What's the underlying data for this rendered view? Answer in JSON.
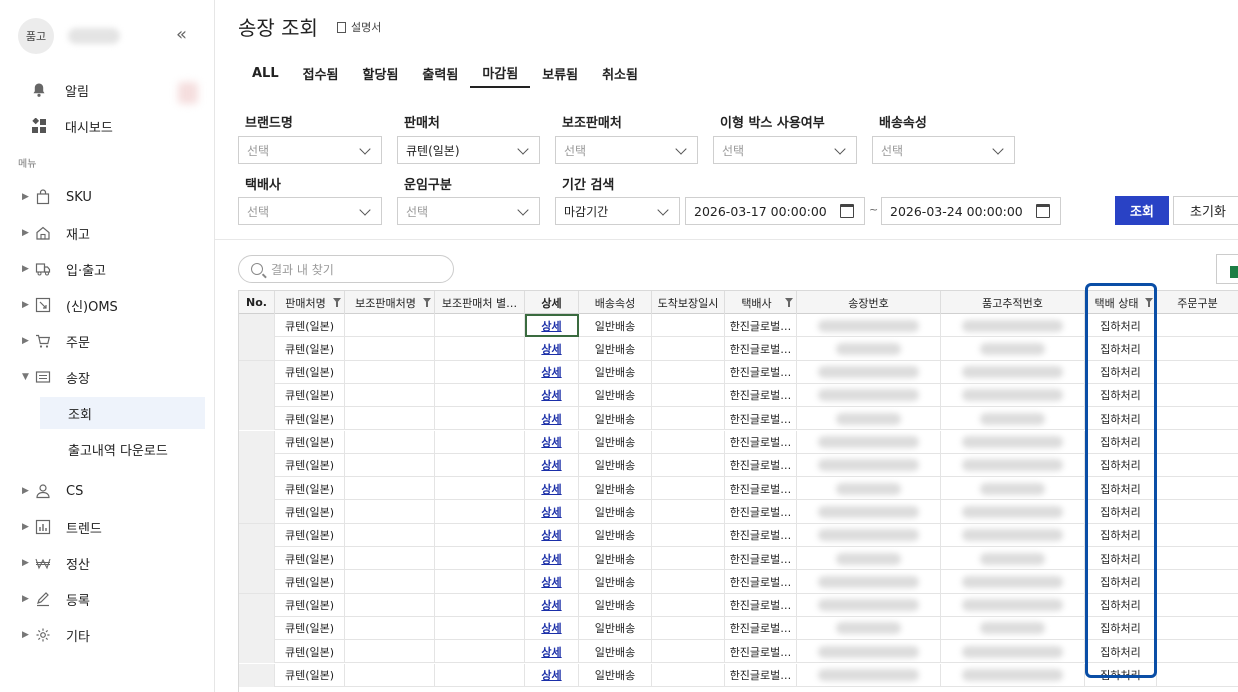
{
  "sidebar": {
    "avatar_text": "품고",
    "collapse_glyph": "«",
    "top_items": [
      {
        "label": "알림",
        "icon": "bell-icon"
      },
      {
        "label": "대시보드",
        "icon": "dashboard-icon"
      }
    ],
    "menu_label": "메뉴",
    "items": [
      {
        "label": "SKU",
        "icon": "bag-icon"
      },
      {
        "label": "재고",
        "icon": "home-icon"
      },
      {
        "label": "입·출고",
        "icon": "truck-icon"
      },
      {
        "label": "(신)OMS",
        "icon": "oms-icon"
      },
      {
        "label": "주문",
        "icon": "cart-icon"
      },
      {
        "label": "송장",
        "icon": "invoice-icon",
        "expanded": true
      },
      {
        "label": "CS",
        "icon": "person-icon"
      },
      {
        "label": "트렌드",
        "icon": "chart-icon"
      },
      {
        "label": "정산",
        "icon": "won-icon"
      },
      {
        "label": "등록",
        "icon": "pencil-icon"
      },
      {
        "label": "기타",
        "icon": "gear-icon"
      }
    ],
    "sub_items": [
      {
        "label": "조회",
        "active": true
      },
      {
        "label": "출고내역 다운로드",
        "active": false
      }
    ]
  },
  "header": {
    "title": "송장 조회",
    "manual_label": "설명서"
  },
  "tabs": [
    {
      "label": "ALL"
    },
    {
      "label": "접수됨"
    },
    {
      "label": "할당됨"
    },
    {
      "label": "출력됨"
    },
    {
      "label": "마감됨",
      "active": true
    },
    {
      "label": "보류됨"
    },
    {
      "label": "취소됨"
    }
  ],
  "filters": {
    "brand": {
      "label": "브랜드명",
      "value": "선택"
    },
    "seller": {
      "label": "판매처",
      "value": "큐텐(일본)"
    },
    "sub_seller": {
      "label": "보조판매처",
      "value": "선택"
    },
    "odd_box": {
      "label": "이형 박스 사용여부",
      "value": "선택"
    },
    "delivery_attr": {
      "label": "배송속성",
      "value": "선택"
    },
    "courier": {
      "label": "택배사",
      "value": "선택"
    },
    "fare_type": {
      "label": "운임구분",
      "value": "선택"
    },
    "period": {
      "label": "기간 검색",
      "value": "마감기간",
      "from": "2026-03-17 00:00:00",
      "to": "2026-03-24 00:00:00",
      "separator": "~"
    },
    "search_button": "조회",
    "reset_button": "초기화"
  },
  "grid": {
    "search_placeholder": "결과 내 찾기",
    "columns": [
      "No.",
      "판매처명",
      "보조판매처명",
      "보조판매처 별…",
      "상세",
      "배송속성",
      "도착보장일시",
      "택배사",
      "송장번호",
      "품고추적번호",
      "택배 상태",
      "주문구분"
    ],
    "row_values": {
      "seller": "큐텐(일본)",
      "detail": "상세",
      "delivery_attr": "일반배송",
      "courier": "한진글로벌…",
      "status": "집하처리"
    },
    "row_count": 16
  }
}
